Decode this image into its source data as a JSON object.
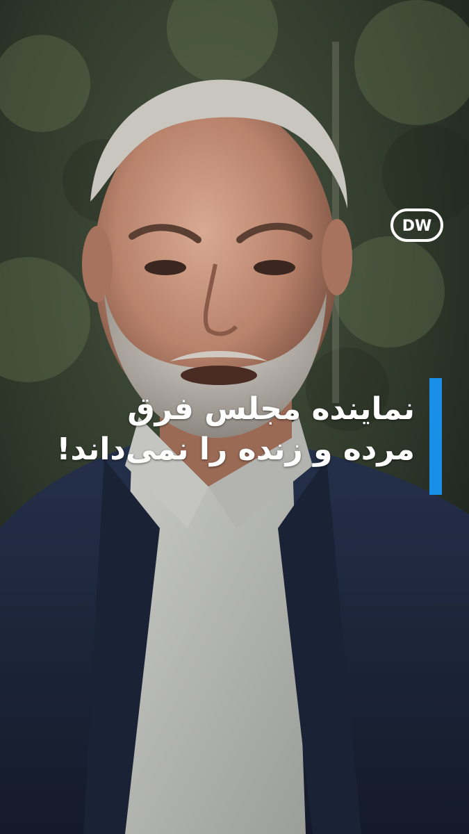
{
  "brand": {
    "logo_text": "DW",
    "logo_color": "#ffffff"
  },
  "headline": {
    "line1": "نماینده مجلس فرق",
    "line2": "مرده و زنده را نمی‌داند!"
  },
  "colors": {
    "accent": "#1a8fe8",
    "jacket": "#1b2338",
    "shirt": "#b7b8b4",
    "background_foliage": "#3a4535"
  }
}
